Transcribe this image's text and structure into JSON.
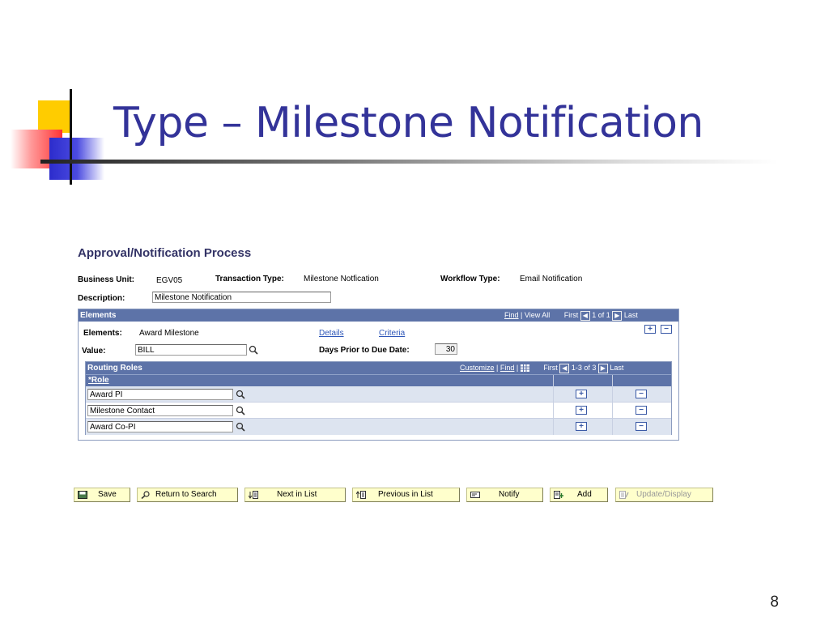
{
  "slide": {
    "title": "Type – Milestone Notification",
    "page_number": "8"
  },
  "app": {
    "page_heading": "Approval/Notification Process",
    "business_unit_label": "Business Unit:",
    "business_unit_value": "EGV05",
    "transaction_type_label": "Transaction Type:",
    "transaction_type_value": "Milestone Notfication",
    "workflow_type_label": "Workflow Type:",
    "workflow_type_value": "Email Notification",
    "description_label": "Description:",
    "description_value": "Milestone Notification",
    "elements_grid": {
      "title": "Elements",
      "find": "Find",
      "separator": "|",
      "view_all": "View All",
      "first": "First",
      "range": "1 of 1",
      "last": "Last",
      "elements_label": "Elements:",
      "elements_value": "Award Milestone",
      "details_link": "Details",
      "criteria_link": "Criteria",
      "value_label": "Value:",
      "value_value": "BILL",
      "days_prior_label": "Days Prior to Due Date:",
      "days_prior_value": "30"
    },
    "routing_roles": {
      "title": "Routing Roles",
      "customize": "Customize",
      "find": "Find",
      "separator": "|",
      "first": "First",
      "range": "1-3 of 3",
      "last": "Last",
      "role_header": "*Role",
      "rows": [
        {
          "role": "Award PI"
        },
        {
          "role": "Milestone Contact"
        },
        {
          "role": "Award Co-PI"
        }
      ]
    }
  },
  "toolbar": {
    "save": "Save",
    "return_to_search": "Return to Search",
    "next_in_list": "Next in List",
    "previous_in_list": "Previous in List",
    "notify": "Notify",
    "add": "Add",
    "update_display": "Update/Display"
  },
  "colors": {
    "title": "#333399",
    "grid_header": "#5d73a8",
    "link": "#2e56b8",
    "toolbar_bg": "#ffffcc"
  }
}
